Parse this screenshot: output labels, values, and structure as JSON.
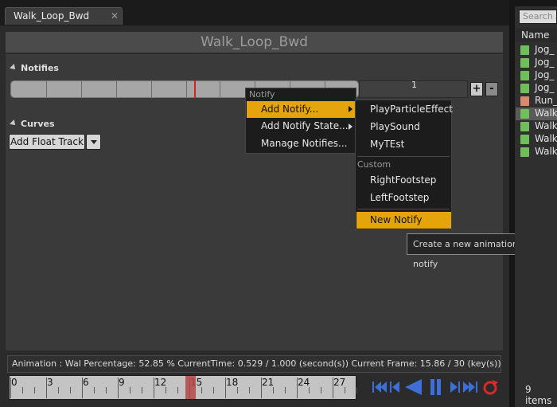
{
  "tab": {
    "title": "Walk_Loop_Bwd",
    "close": "✕"
  },
  "panel_title": "Walk_Loop_Bwd",
  "notifies": {
    "label": "Notifies",
    "track_number": "1",
    "add_btn": "+",
    "remove_btn": "-"
  },
  "curves": {
    "label": "Curves",
    "add_float_track": "Add Float Track"
  },
  "context_menu": {
    "header": "Notify",
    "items": [
      "Add Notify...",
      "Add Notify State...",
      "Manage Notifies..."
    ]
  },
  "submenu": {
    "items": [
      "PlayParticleEffect",
      "PlaySound",
      "MyTEst"
    ],
    "custom_header": "Custom",
    "custom_items": [
      "RightFootstep",
      "LeftFootstep"
    ],
    "new_notify": "New Notify"
  },
  "tooltip": "Create a new animation notify",
  "status_bar": "Animation : Wal Percentage:  52.85 % CurrentTime:  0.529 / 1.000 (second(s)) Current Frame:  15.86 / 30 (key(s))",
  "timeline": {
    "labels": [
      "0",
      "3",
      "6",
      "9",
      "12",
      "15",
      "18",
      "21",
      "24",
      "27"
    ],
    "current_frame": 15.86,
    "total_frames": 30
  },
  "transport_icons": [
    "skip-to-start-icon",
    "step-back-icon",
    "play-reverse-icon",
    "pause-icon",
    "step-forward-icon",
    "skip-to-end-icon",
    "loop-icon"
  ],
  "content_browser": {
    "search_placeholder": "Search A",
    "column": "Name",
    "assets": [
      "Jog_",
      "Jog_",
      "Jog_",
      "Jog_",
      "Run_",
      "Walk_",
      "Walk_",
      "Walk_",
      "Walk_"
    ],
    "asset_colors": [
      "#6fbf5a",
      "#6fbf5a",
      "#6fbf5a",
      "#6fbf5a",
      "#d98a6a",
      "#6fbf5a",
      "#6fbf5a",
      "#6fbf5a",
      "#6fbf5a"
    ],
    "count": "9 items"
  },
  "colors": {
    "accent": "#e5a40c",
    "scrub": "#b54848",
    "transport_blue": "#3d6fd6",
    "loop_red": "#d52a2a"
  }
}
